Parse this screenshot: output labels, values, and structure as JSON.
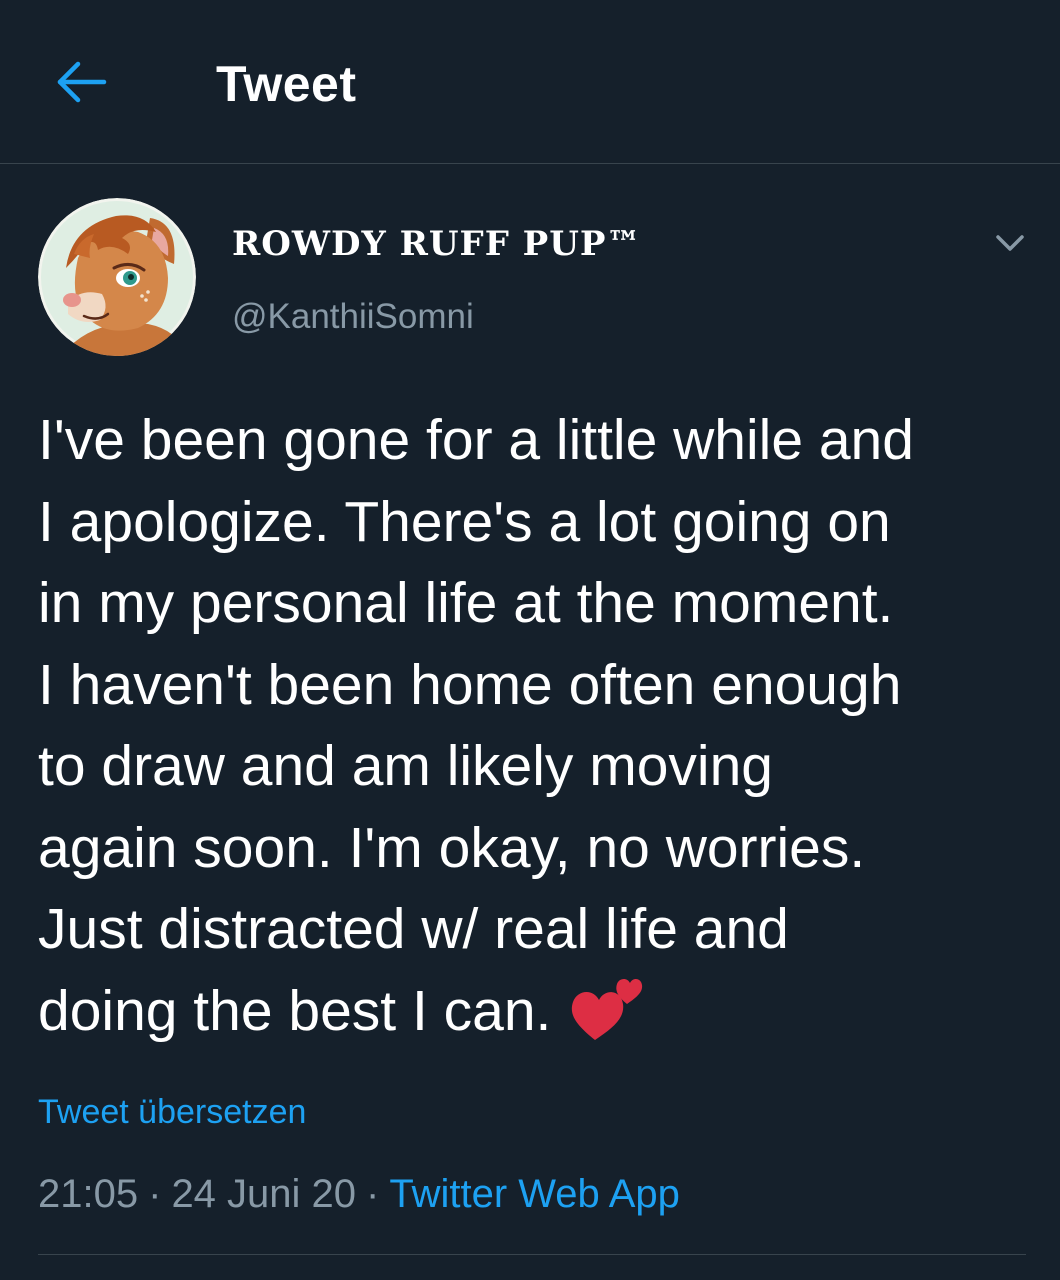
{
  "header": {
    "back_icon": "arrow-left-icon",
    "title": "Tweet"
  },
  "tweet": {
    "avatar_alt": "profile-avatar",
    "display_name": "ROWDY RUFF PUP™",
    "handle": "@KanthiiSomni",
    "caret_icon": "chevron-down-icon",
    "text_lines": [
      "I've been gone for a little while and",
      "I apologize. There's a lot going on",
      "in my personal life at the moment.",
      "I haven't been home often enough",
      "to draw and am likely moving",
      "again soon. I'm okay, no worries.",
      "Just distracted w/ real life and",
      "doing the best I can."
    ],
    "emoji": "two-hearts-emoji",
    "translate_label": "Tweet übersetzen",
    "time": "21:05",
    "date": "24 Juni 20",
    "separator": "·",
    "source": "Twitter Web App"
  },
  "colors": {
    "background": "#15202b",
    "accent": "#1da1f2",
    "secondary_text": "#8899a6",
    "divider": "#38444d",
    "heart": "#e0245e"
  }
}
